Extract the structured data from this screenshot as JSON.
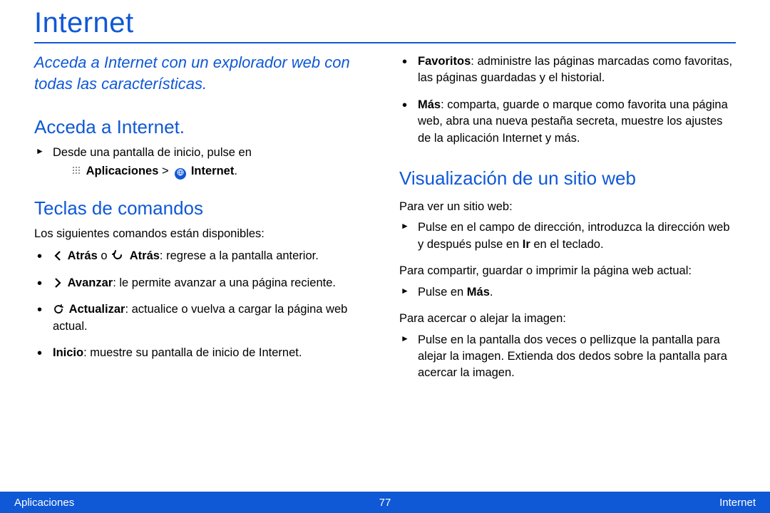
{
  "title": "Internet",
  "intro": "Acceda a Internet con un explorador web con todas las características.",
  "section_access": {
    "heading": "Acceda a Internet.",
    "step_pre": "Desde una pantalla de inicio, pulse en",
    "path_apps": "Aplicaciones",
    "path_sep": ">",
    "path_internet": "Internet",
    "path_end": "."
  },
  "section_commands": {
    "heading": "Teclas de comandos",
    "intro": "Los siguientes comandos están disponibles:",
    "back_label1": "Atrás",
    "back_or": " o ",
    "back_label2": "Atrás",
    "back_desc": ": regrese a la pantalla anterior.",
    "forward_label": "Avanzar",
    "forward_desc": ": le permite avanzar a una página reciente.",
    "refresh_label": "Actualizar",
    "refresh_desc": ": actualice o vuelva a cargar la página web actual.",
    "home_label": "Inicio",
    "home_desc": ": muestre su pantalla de inicio de Internet."
  },
  "right_bullets": {
    "fav_label": "Favoritos",
    "fav_desc": ": administre las páginas marcadas como favoritas, las páginas guardadas y el historial.",
    "more_label": "Más",
    "more_desc": ": comparta, guarde o marque como favorita una página web, abra una nueva pestaña secreta, muestre los ajustes de la aplicación Internet y más."
  },
  "section_view": {
    "heading": "Visualización de un sitio web",
    "para1": "Para ver un sitio web:",
    "step1_pre": "Pulse en el campo de dirección, introduzca la dirección web y después pulse en ",
    "step1_bold": "Ir",
    "step1_post": " en el teclado.",
    "para2": "Para compartir, guardar o imprimir la página web actual:",
    "step2_pre": "Pulse en ",
    "step2_bold": "Más",
    "step2_post": ".",
    "para3": "Para acercar o alejar la imagen:",
    "step3": "Pulse en la pantalla dos veces o pellizque la pantalla para alejar la imagen. Extienda dos dedos sobre la pantalla para acercar la imagen."
  },
  "footer": {
    "left": "Aplicaciones",
    "center": "77",
    "right": "Internet"
  }
}
